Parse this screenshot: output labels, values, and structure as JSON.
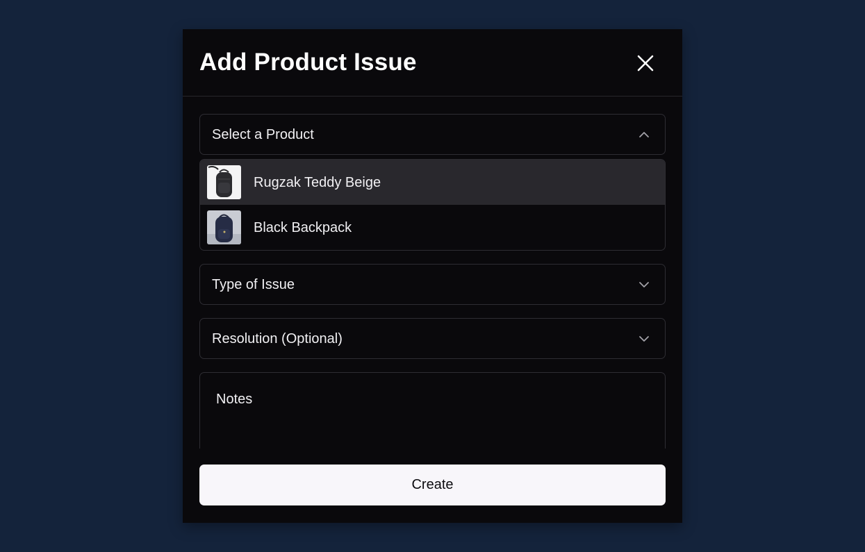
{
  "modal": {
    "title": "Add Product Issue",
    "close_icon": "close-icon"
  },
  "product_select": {
    "label": "Select a Product",
    "icon": "chevron-up-icon",
    "expanded": true,
    "options": [
      {
        "label": "Rugzak Teddy Beige",
        "thumbnail": "backpack-image",
        "highlighted": true
      },
      {
        "label": "Black Backpack",
        "thumbnail": "backpack-image",
        "highlighted": false
      }
    ]
  },
  "issue_type_select": {
    "label": "Type of Issue",
    "icon": "chevron-down-icon"
  },
  "resolution_select": {
    "label": "Resolution (Optional)",
    "icon": "chevron-down-icon"
  },
  "notes": {
    "placeholder": "Notes"
  },
  "actions": {
    "create_label": "Create"
  },
  "colors": {
    "page_background": "#14233b",
    "modal_background": "#0a090c",
    "highlighted_option": "#29282d",
    "primary_button": "#f8f6fa"
  }
}
